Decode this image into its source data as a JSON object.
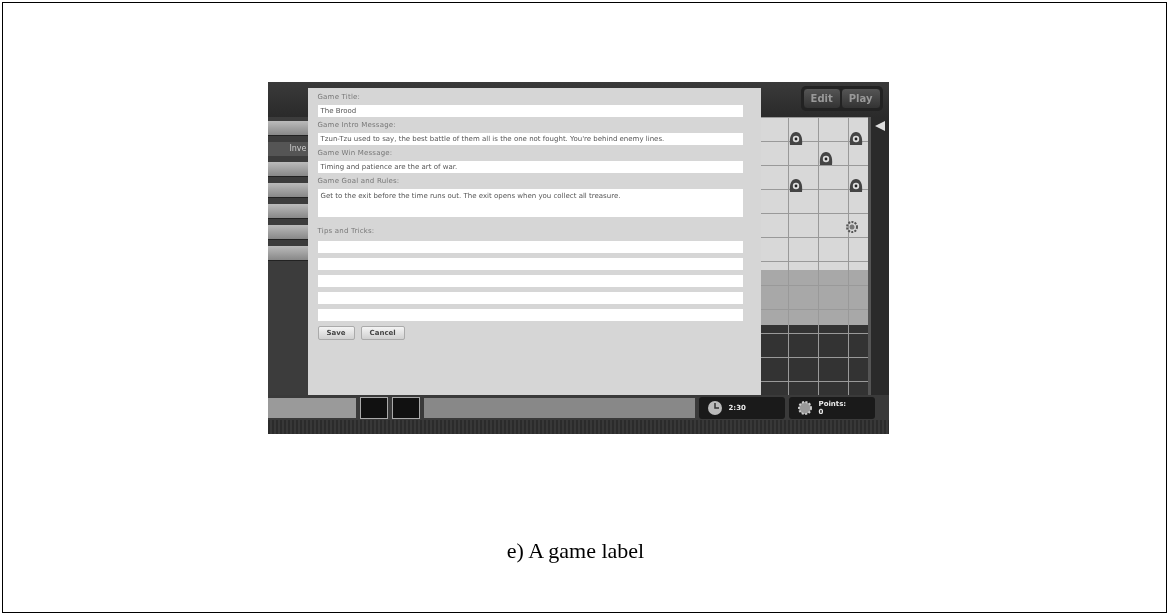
{
  "top_bar": {
    "buttons": [
      {
        "label": "Edit"
      },
      {
        "label": "Play"
      }
    ]
  },
  "sidebar": {
    "tab_label": "Inve"
  },
  "dialog": {
    "fields": [
      {
        "kind": "line",
        "label": "Game Title:",
        "value": "The Brood"
      },
      {
        "kind": "line",
        "label": "Game Intro Message:",
        "value": "Tzun-Tzu used to say, the best battle of them all is the one not fought. You're behind enemy lines."
      },
      {
        "kind": "line",
        "label": "Game Win Message:",
        "value": "Timing and patience are the art of war."
      },
      {
        "kind": "area",
        "label": "Game Goal and Rules:",
        "value": "Get to the exit before the time runs out. The exit opens when you collect all treasure."
      },
      {
        "kind": "lines",
        "label": "Tips and Tricks:"
      }
    ],
    "buttons": [
      "Save",
      "Cancel"
    ]
  },
  "status_bar": {
    "timer": "2:30",
    "points_label": "Points:",
    "points_value": "0"
  },
  "caption": "e) A game label"
}
